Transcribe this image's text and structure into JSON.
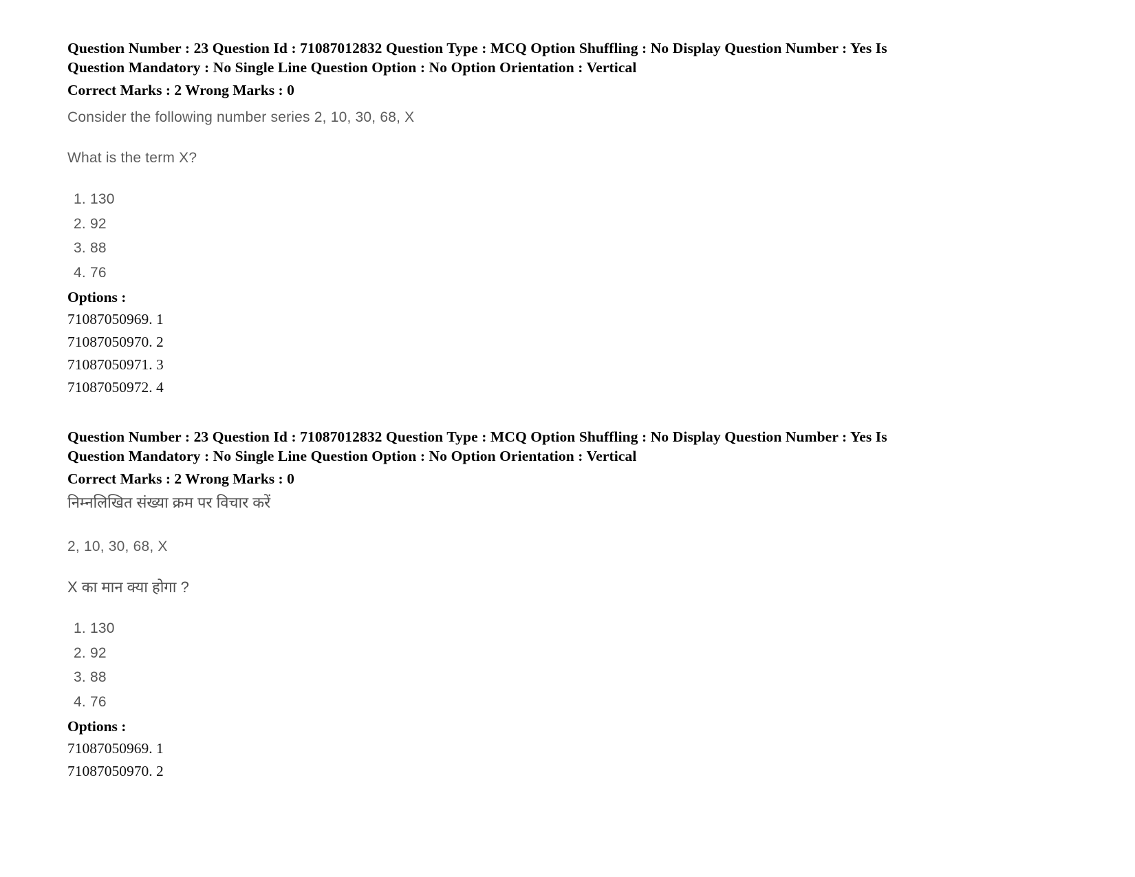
{
  "document": {
    "page_background": "#ffffff",
    "text_color_meta": "#000000",
    "text_color_body": "#5c5c5c"
  },
  "sections": [
    {
      "id": "question-23-english",
      "meta_line_1": "Question Number : 23 Question Id : 71087012832 Question Type : MCQ Option Shuffling : No Display Question Number : Yes Is",
      "meta_line_2": "Question Mandatory : No Single Line Question Option : No Option Orientation : Vertical",
      "marks_line": "Correct Marks : 2 Wrong Marks : 0",
      "question_lines": [
        "Consider the following number series 2, 10, 30, 68, X",
        "What is the term X?"
      ],
      "choices": [
        "1. 130",
        "2. 92",
        "3. 88",
        "4. 76"
      ],
      "options_label": "Options :",
      "option_ids": [
        "71087050969. 1",
        "71087050970. 2",
        "71087050971. 3",
        "71087050972. 4"
      ]
    },
    {
      "id": "question-23-hindi",
      "meta_line_1": "Question Number : 23 Question Id : 71087012832 Question Type : MCQ Option Shuffling : No Display Question Number : Yes Is",
      "meta_line_2": "Question Mandatory : No Single Line Question Option : No Option Orientation : Vertical",
      "marks_line": "Correct Marks : 2 Wrong Marks : 0",
      "question_lines": [
        "निम्नलिखित संख्या क्रम पर विचार करें",
        "2, 10, 30, 68, X",
        "X का मान क्या होगा ?"
      ],
      "choices": [
        "1. 130",
        "2. 92",
        "3. 88",
        "4. 76"
      ],
      "options_label": "Options :",
      "option_ids": [
        "71087050969. 1",
        "71087050970. 2"
      ]
    }
  ]
}
